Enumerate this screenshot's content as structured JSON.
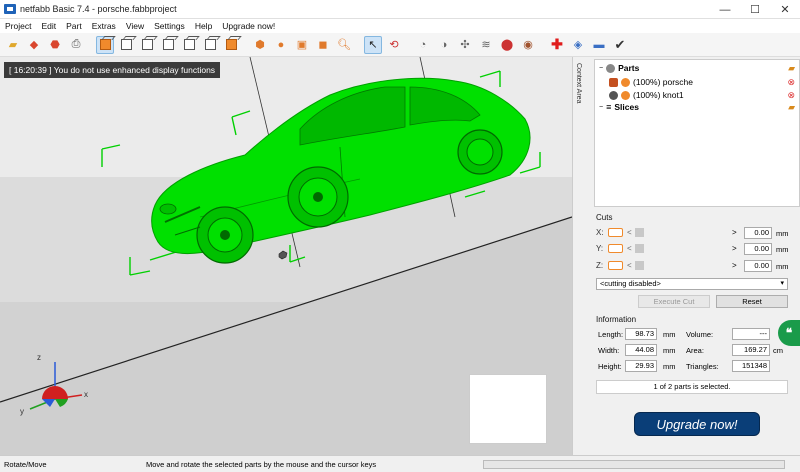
{
  "window": {
    "title": "netfabb Basic 7.4 - porsche.fabbproject",
    "minimize": "—",
    "maximize": "☐",
    "close": "✕"
  },
  "menu": [
    "Project",
    "Edit",
    "Part",
    "Extras",
    "View",
    "Settings",
    "Help",
    "Upgrade now!"
  ],
  "viewport": {
    "message": "[ 16:20:39 ] You do not use enhanced display functions",
    "axes": {
      "x": "x",
      "y": "y",
      "z": "z"
    }
  },
  "side_tab": "Context Area",
  "tree": {
    "parts_label": "Parts",
    "items": [
      {
        "label": "(100%) porsche"
      },
      {
        "label": "(100%) knot1"
      }
    ],
    "slices_label": "Slices"
  },
  "cuts": {
    "label": "Cuts",
    "rows": [
      {
        "axis": "X:",
        "value": "0.00",
        "unit": "mm"
      },
      {
        "axis": "Y:",
        "value": "0.00",
        "unit": "mm"
      },
      {
        "axis": "Z:",
        "value": "0.00",
        "unit": "mm"
      }
    ],
    "mode": "<cutting disabled>",
    "execute_label": "Execute Cut",
    "reset_label": "Reset"
  },
  "info": {
    "label": "Information",
    "length_label": "Length:",
    "length": "98.73",
    "length_unit": "mm",
    "width_label": "Width:",
    "width": "44.08",
    "width_unit": "mm",
    "height_label": "Height:",
    "height": "29.93",
    "height_unit": "mm",
    "volume_label": "Volume:",
    "volume": "---",
    "area_label": "Area:",
    "area": "169.27",
    "area_unit": "cm",
    "triangles_label": "Triangles:",
    "triangles": "151348",
    "selection": "1 of 2 parts is selected."
  },
  "upgrade_label": "Upgrade now!",
  "chat_glyph": "❝",
  "status": {
    "mode": "Rotate/Move",
    "hint": "Move and rotate the selected parts by the mouse and the cursor keys"
  },
  "colors": {
    "selection_green": "#00e000",
    "upgrade_blue": "#0a3e78",
    "accent_orange": "#f08a2c"
  }
}
